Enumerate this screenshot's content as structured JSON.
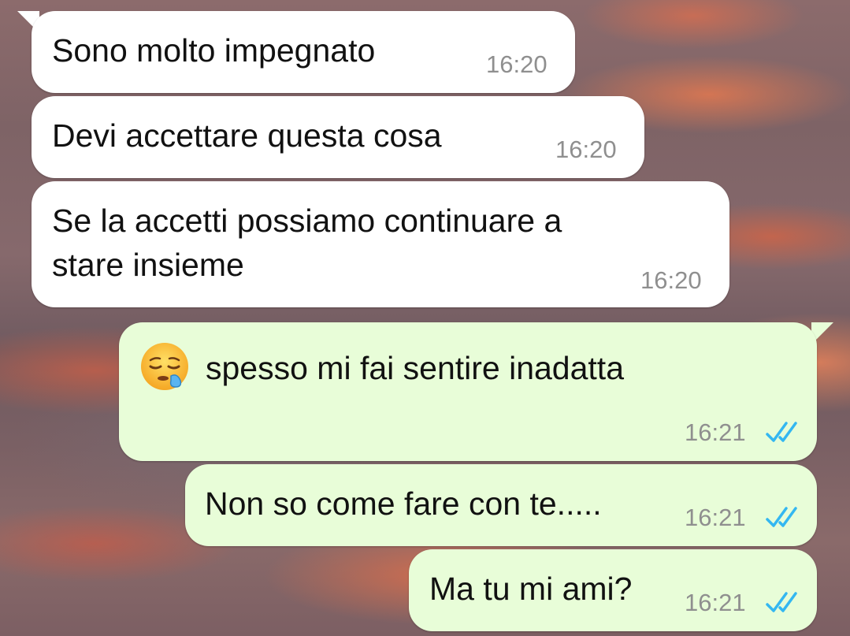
{
  "messages": [
    {
      "direction": "incoming",
      "text": "Sono molto impegnato",
      "time": "16:20"
    },
    {
      "direction": "incoming",
      "text": "Devi accettare questa cosa",
      "time": "16:20"
    },
    {
      "direction": "incoming",
      "text": "Se la accetti possiamo continuare a\nstare insieme",
      "time": "16:20"
    },
    {
      "direction": "outgoing",
      "emoji": "sleepy-face-emoji",
      "text": "spesso mi fai sentire inadatta",
      "time": "16:21",
      "status": "read"
    },
    {
      "direction": "outgoing",
      "text": "Non so come fare con te.....",
      "time": "16:21",
      "status": "read"
    },
    {
      "direction": "outgoing",
      "text": "Ma tu mi ami?",
      "time": "16:21",
      "status": "read"
    }
  ],
  "colors": {
    "incoming_bubble": "#ffffff",
    "outgoing_bubble": "#e8fdd8",
    "timestamp": "#8f8f8f",
    "read_ticks": "#34b7f1"
  }
}
